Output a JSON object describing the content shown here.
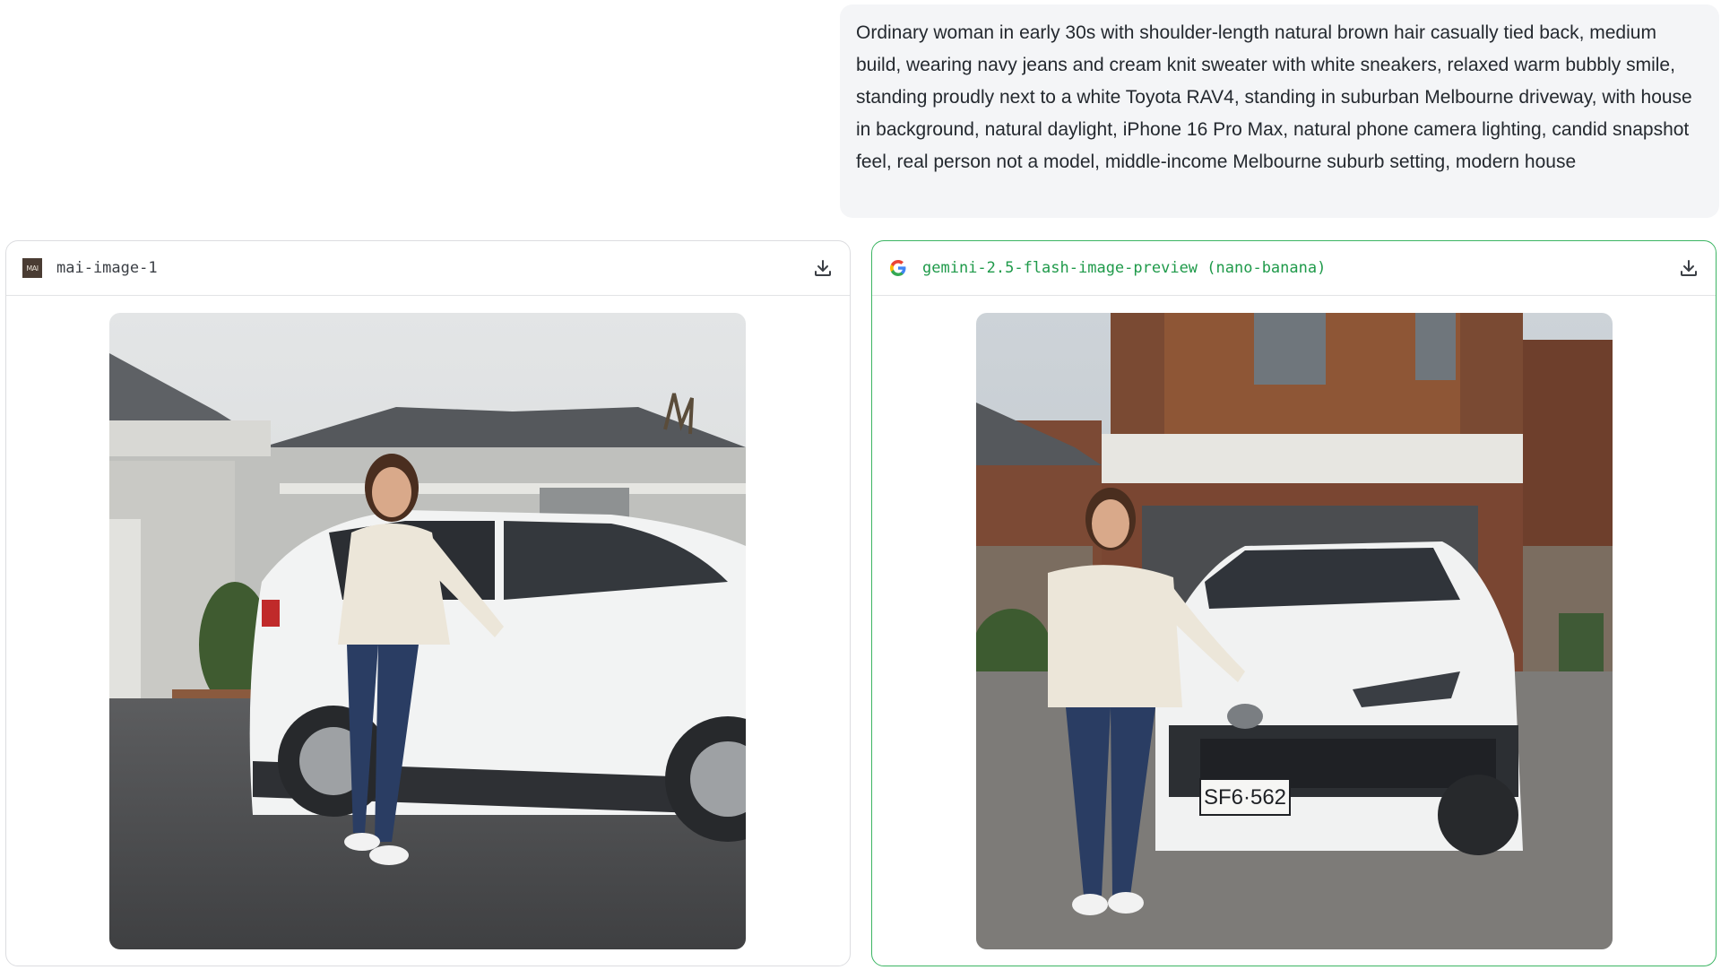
{
  "prompt": {
    "text": "Ordinary woman in early 30s with shoulder-length natural brown hair casually tied back, medium build, wearing navy jeans and cream knit sweater with white sneakers, relaxed warm bubbly smile, standing proudly next to a white Toyota RAV4, standing in suburban Melbourne driveway, with house in background, natural daylight, iPhone 16 Pro Max, natural phone camera lighting, candid snapshot feel, real person not a model, middle-income Melbourne suburb setting, modern house"
  },
  "panels": [
    {
      "model": "mai-image-1",
      "icon": "mai-logo-icon",
      "icon_text": "MAI",
      "download_icon": "download-icon"
    },
    {
      "model": "gemini-2.5-flash-image-preview (nano-banana)",
      "icon": "google-logo-icon",
      "download_icon": "download-icon",
      "selected": true,
      "accent": "#1f9a4a",
      "plate_text": "SF6·562"
    }
  ],
  "colors": {
    "bubble_bg": "#f4f5f7",
    "selected_border": "#3cb563",
    "default_border": "#dcdde0"
  }
}
